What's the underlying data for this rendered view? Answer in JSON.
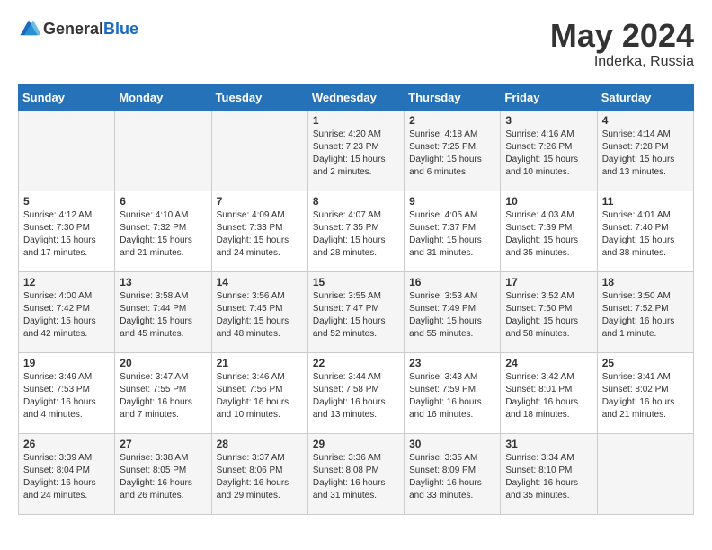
{
  "header": {
    "logo_general": "General",
    "logo_blue": "Blue",
    "month_year": "May 2024",
    "location": "Inderka, Russia"
  },
  "days_of_week": [
    "Sunday",
    "Monday",
    "Tuesday",
    "Wednesday",
    "Thursday",
    "Friday",
    "Saturday"
  ],
  "weeks": [
    [
      {
        "day": "",
        "detail": ""
      },
      {
        "day": "",
        "detail": ""
      },
      {
        "day": "",
        "detail": ""
      },
      {
        "day": "1",
        "detail": "Sunrise: 4:20 AM\nSunset: 7:23 PM\nDaylight: 15 hours\nand 2 minutes."
      },
      {
        "day": "2",
        "detail": "Sunrise: 4:18 AM\nSunset: 7:25 PM\nDaylight: 15 hours\nand 6 minutes."
      },
      {
        "day": "3",
        "detail": "Sunrise: 4:16 AM\nSunset: 7:26 PM\nDaylight: 15 hours\nand 10 minutes."
      },
      {
        "day": "4",
        "detail": "Sunrise: 4:14 AM\nSunset: 7:28 PM\nDaylight: 15 hours\nand 13 minutes."
      }
    ],
    [
      {
        "day": "5",
        "detail": "Sunrise: 4:12 AM\nSunset: 7:30 PM\nDaylight: 15 hours\nand 17 minutes."
      },
      {
        "day": "6",
        "detail": "Sunrise: 4:10 AM\nSunset: 7:32 PM\nDaylight: 15 hours\nand 21 minutes."
      },
      {
        "day": "7",
        "detail": "Sunrise: 4:09 AM\nSunset: 7:33 PM\nDaylight: 15 hours\nand 24 minutes."
      },
      {
        "day": "8",
        "detail": "Sunrise: 4:07 AM\nSunset: 7:35 PM\nDaylight: 15 hours\nand 28 minutes."
      },
      {
        "day": "9",
        "detail": "Sunrise: 4:05 AM\nSunset: 7:37 PM\nDaylight: 15 hours\nand 31 minutes."
      },
      {
        "day": "10",
        "detail": "Sunrise: 4:03 AM\nSunset: 7:39 PM\nDaylight: 15 hours\nand 35 minutes."
      },
      {
        "day": "11",
        "detail": "Sunrise: 4:01 AM\nSunset: 7:40 PM\nDaylight: 15 hours\nand 38 minutes."
      }
    ],
    [
      {
        "day": "12",
        "detail": "Sunrise: 4:00 AM\nSunset: 7:42 PM\nDaylight: 15 hours\nand 42 minutes."
      },
      {
        "day": "13",
        "detail": "Sunrise: 3:58 AM\nSunset: 7:44 PM\nDaylight: 15 hours\nand 45 minutes."
      },
      {
        "day": "14",
        "detail": "Sunrise: 3:56 AM\nSunset: 7:45 PM\nDaylight: 15 hours\nand 48 minutes."
      },
      {
        "day": "15",
        "detail": "Sunrise: 3:55 AM\nSunset: 7:47 PM\nDaylight: 15 hours\nand 52 minutes."
      },
      {
        "day": "16",
        "detail": "Sunrise: 3:53 AM\nSunset: 7:49 PM\nDaylight: 15 hours\nand 55 minutes."
      },
      {
        "day": "17",
        "detail": "Sunrise: 3:52 AM\nSunset: 7:50 PM\nDaylight: 15 hours\nand 58 minutes."
      },
      {
        "day": "18",
        "detail": "Sunrise: 3:50 AM\nSunset: 7:52 PM\nDaylight: 16 hours\nand 1 minute."
      }
    ],
    [
      {
        "day": "19",
        "detail": "Sunrise: 3:49 AM\nSunset: 7:53 PM\nDaylight: 16 hours\nand 4 minutes."
      },
      {
        "day": "20",
        "detail": "Sunrise: 3:47 AM\nSunset: 7:55 PM\nDaylight: 16 hours\nand 7 minutes."
      },
      {
        "day": "21",
        "detail": "Sunrise: 3:46 AM\nSunset: 7:56 PM\nDaylight: 16 hours\nand 10 minutes."
      },
      {
        "day": "22",
        "detail": "Sunrise: 3:44 AM\nSunset: 7:58 PM\nDaylight: 16 hours\nand 13 minutes."
      },
      {
        "day": "23",
        "detail": "Sunrise: 3:43 AM\nSunset: 7:59 PM\nDaylight: 16 hours\nand 16 minutes."
      },
      {
        "day": "24",
        "detail": "Sunrise: 3:42 AM\nSunset: 8:01 PM\nDaylight: 16 hours\nand 18 minutes."
      },
      {
        "day": "25",
        "detail": "Sunrise: 3:41 AM\nSunset: 8:02 PM\nDaylight: 16 hours\nand 21 minutes."
      }
    ],
    [
      {
        "day": "26",
        "detail": "Sunrise: 3:39 AM\nSunset: 8:04 PM\nDaylight: 16 hours\nand 24 minutes."
      },
      {
        "day": "27",
        "detail": "Sunrise: 3:38 AM\nSunset: 8:05 PM\nDaylight: 16 hours\nand 26 minutes."
      },
      {
        "day": "28",
        "detail": "Sunrise: 3:37 AM\nSunset: 8:06 PM\nDaylight: 16 hours\nand 29 minutes."
      },
      {
        "day": "29",
        "detail": "Sunrise: 3:36 AM\nSunset: 8:08 PM\nDaylight: 16 hours\nand 31 minutes."
      },
      {
        "day": "30",
        "detail": "Sunrise: 3:35 AM\nSunset: 8:09 PM\nDaylight: 16 hours\nand 33 minutes."
      },
      {
        "day": "31",
        "detail": "Sunrise: 3:34 AM\nSunset: 8:10 PM\nDaylight: 16 hours\nand 35 minutes."
      },
      {
        "day": "",
        "detail": ""
      }
    ]
  ]
}
